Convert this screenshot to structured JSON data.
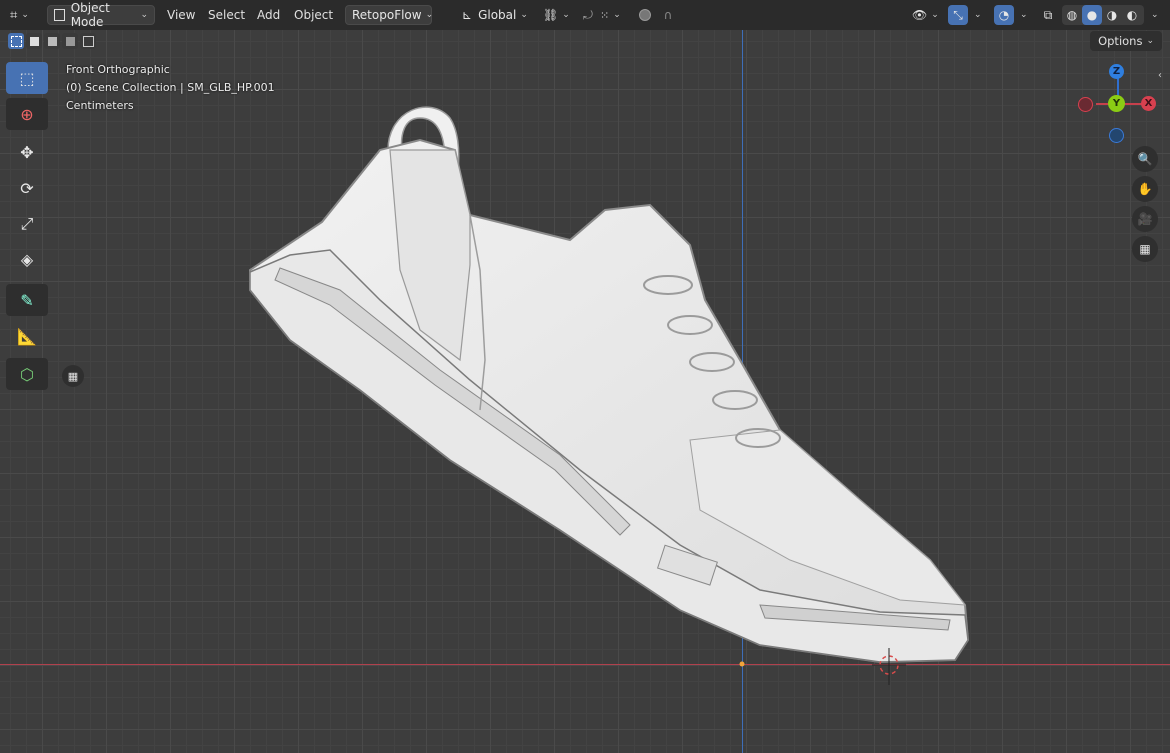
{
  "header": {
    "editor_icon": "editor-type-icon",
    "mode": "Object Mode",
    "menus": [
      "View",
      "Select",
      "Add",
      "Object"
    ],
    "addon_menu": "RetopoFlow",
    "orientation": "Global",
    "snap_icon": "snap-icon",
    "proportional_icon": "proportional-edit-icon",
    "overlay_icons": [
      "visibility-icon",
      "gizmo-icon",
      "overlay-icon",
      "xray-icon"
    ],
    "shading_modes": [
      "wireframe",
      "solid",
      "material",
      "rendered"
    ],
    "active_shading": "solid"
  },
  "selection_modes": [
    "new",
    "extend",
    "subtract",
    "invert",
    "intersect"
  ],
  "toolbar": {
    "tools": [
      "select-box",
      "cursor",
      "move",
      "rotate",
      "scale",
      "transform",
      "annotate",
      "measure",
      "add-cube"
    ],
    "active": "select-box"
  },
  "viewport_info": {
    "view": "Front Orthographic",
    "collection": "(0) Scene Collection | SM_GLB_HP.001",
    "units": "Centimeters"
  },
  "options_label": "Options",
  "gizmo": {
    "z": "Z",
    "y": "Y",
    "x": "X"
  },
  "colors": {
    "header_bg": "#2b2b2b",
    "viewport_bg": "#3d3d3d",
    "accent": "#4772b3",
    "axis_x": "#ff3352",
    "axis_y": "#8bdc00",
    "axis_z": "#2890ff"
  },
  "model": {
    "name": "SM_GLB_HP.001",
    "type": "sneaker-mesh"
  }
}
